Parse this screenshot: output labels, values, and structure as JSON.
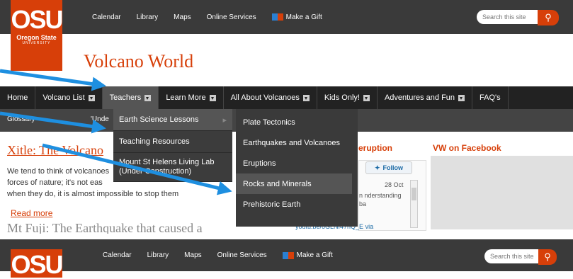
{
  "topbar": {
    "logo_text": "OSU",
    "logo_sub": "Oregon State",
    "logo_univ": "UNIVERSITY",
    "links": [
      "Calendar",
      "Library",
      "Maps",
      "Online Services"
    ],
    "gift_label": "Make a Gift",
    "search_placeholder": "Search this site"
  },
  "site_name": "Volcano World",
  "main_nav": [
    {
      "label": "Home",
      "dropdown": false
    },
    {
      "label": "Volcano List",
      "dropdown": true
    },
    {
      "label": "Teachers",
      "dropdown": true
    },
    {
      "label": "Learn More",
      "dropdown": true
    },
    {
      "label": "All About Volcanoes",
      "dropdown": true
    },
    {
      "label": "Kids Only!",
      "dropdown": true
    },
    {
      "label": "Adventures and Fun",
      "dropdown": true
    },
    {
      "label": "FAQ's",
      "dropdown": false
    }
  ],
  "sub_nav": {
    "glossary": "Glossary",
    "partial": "'Unde"
  },
  "teachers_menu": [
    "Earth Science Lessons",
    "Teaching Resources",
    "Mount St Helens Living Lab (Under Construction)"
  ],
  "lessons_menu": [
    "Plate Tectonics",
    "Earthquakes and Volcanoes",
    "Eruptions",
    "Rocks and Minerals",
    "Prehistoric Earth"
  ],
  "article": {
    "title": "Xitle: The Volcano",
    "body_1": "We tend to think of volcanoes",
    "body_2": "forces of nature; it's not eas",
    "body_3": "when they do, it is almost impossible to stop them",
    "read_more": "Read more",
    "next_title": "Mt Fuji: The Earthquake that caused a"
  },
  "sidebar": {
    "eruption_heading": "eruption",
    "follow_label": "Follow",
    "tweet_date": "28 Oct",
    "tweet_text": "n nderstanding ba",
    "tweet_url": "youtu.be/6GLNI47nQ_E via",
    "facebook_heading": "VW on Facebook"
  },
  "colors": {
    "brand_orange": "#d73f09",
    "nav_dark": "#222222",
    "topbar": "#3a3a3a"
  }
}
